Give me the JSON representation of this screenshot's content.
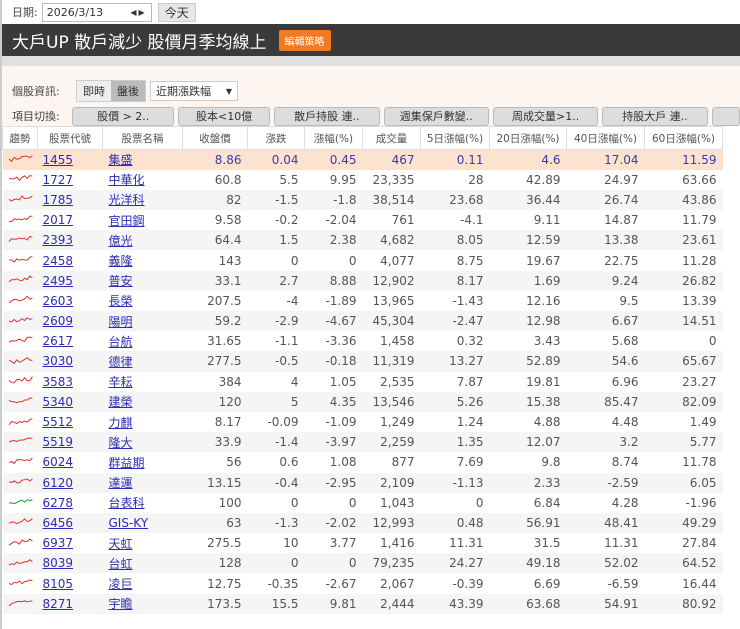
{
  "date_label": "日期:",
  "date_value": "2026/3/13",
  "today_button": "今天",
  "title": "大戶UP 散戶減少 股價月季均線上",
  "edit_button": "編輯策略",
  "info_label": "個股資訊:",
  "info_modes": [
    "即時",
    "盤後"
  ],
  "info_select": "近期漲跌幅",
  "switch_label": "項目切換:",
  "switch_buttons": [
    "股價 > 2..",
    "股本<10億",
    "散戶持股 連..",
    "週集保戶數變..",
    "周成交量>1..",
    "持股大戶 連.."
  ],
  "columns": [
    "趨勢",
    "股票代號",
    "股票名稱",
    "收盤價",
    "漲跌",
    "漲幅(%)",
    "成交量",
    "5日漲幅(%)",
    "20日漲幅(%)",
    "40日漲幅(%)",
    "60日漲幅(%)"
  ],
  "colors": {
    "accent": "#f47a20",
    "up": "#e03030",
    "down": "#2a9a2a",
    "highlight": "#fde3cf"
  },
  "rows": [
    [
      "1455",
      "集盛",
      "8.86",
      "0.04",
      "0.45",
      "467",
      "0.11",
      "4.6",
      "17.04",
      "11.59"
    ],
    [
      "1727",
      "中華化",
      "60.8",
      "5.5",
      "9.95",
      "23,335",
      "28",
      "42.89",
      "24.97",
      "63.66"
    ],
    [
      "1785",
      "光洋科",
      "82",
      "-1.5",
      "-1.8",
      "38,514",
      "23.68",
      "36.44",
      "26.74",
      "43.86"
    ],
    [
      "2017",
      "官田鋼",
      "9.58",
      "-0.2",
      "-2.04",
      "761",
      "-4.1",
      "9.11",
      "14.87",
      "11.79"
    ],
    [
      "2393",
      "億光",
      "64.4",
      "1.5",
      "2.38",
      "4,682",
      "8.05",
      "12.59",
      "13.38",
      "23.61"
    ],
    [
      "2458",
      "義隆",
      "143",
      "0",
      "0",
      "4,077",
      "8.75",
      "19.67",
      "22.75",
      "11.28"
    ],
    [
      "2495",
      "普安",
      "33.1",
      "2.7",
      "8.88",
      "12,902",
      "8.17",
      "1.69",
      "9.24",
      "26.82"
    ],
    [
      "2603",
      "長榮",
      "207.5",
      "-4",
      "-1.89",
      "13,965",
      "-1.43",
      "12.16",
      "9.5",
      "13.39"
    ],
    [
      "2609",
      "陽明",
      "59.2",
      "-2.9",
      "-4.67",
      "45,304",
      "-2.47",
      "12.98",
      "6.67",
      "14.51"
    ],
    [
      "2617",
      "台航",
      "31.65",
      "-1.1",
      "-3.36",
      "1,458",
      "0.32",
      "3.43",
      "5.68",
      "0"
    ],
    [
      "3030",
      "德律",
      "277.5",
      "-0.5",
      "-0.18",
      "11,319",
      "13.27",
      "52.89",
      "54.6",
      "65.67"
    ],
    [
      "3583",
      "辛耘",
      "384",
      "4",
      "1.05",
      "2,535",
      "7.87",
      "19.81",
      "6.96",
      "23.27"
    ],
    [
      "5340",
      "建榮",
      "120",
      "5",
      "4.35",
      "13,546",
      "5.26",
      "15.38",
      "85.47",
      "82.09"
    ],
    [
      "5512",
      "力麒",
      "8.17",
      "-0.09",
      "-1.09",
      "1,249",
      "1.24",
      "4.88",
      "4.48",
      "1.49"
    ],
    [
      "5519",
      "隆大",
      "33.9",
      "-1.4",
      "-3.97",
      "2,259",
      "1.35",
      "12.07",
      "3.2",
      "5.77"
    ],
    [
      "6024",
      "群益期",
      "56",
      "0.6",
      "1.08",
      "877",
      "7.69",
      "9.8",
      "8.74",
      "11.78"
    ],
    [
      "6120",
      "達運",
      "13.15",
      "-0.4",
      "-2.95",
      "2,109",
      "-1.13",
      "2.33",
      "-2.59",
      "6.05"
    ],
    [
      "6278",
      "台表科",
      "100",
      "0",
      "0",
      "1,043",
      "0",
      "6.84",
      "4.28",
      "-1.96"
    ],
    [
      "6456",
      "GIS-KY",
      "63",
      "-1.3",
      "-2.02",
      "12,993",
      "0.48",
      "56.91",
      "48.41",
      "49.29"
    ],
    [
      "6937",
      "天虹",
      "275.5",
      "10",
      "3.77",
      "1,416",
      "11.31",
      "31.5",
      "11.31",
      "27.84"
    ],
    [
      "8039",
      "台虹",
      "128",
      "0",
      "0",
      "79,235",
      "24.27",
      "49.18",
      "52.02",
      "64.52"
    ],
    [
      "8105",
      "凌巨",
      "12.75",
      "-0.35",
      "-2.67",
      "2,067",
      "-0.39",
      "6.69",
      "-6.59",
      "16.44"
    ],
    [
      "8271",
      "宇瞻",
      "173.5",
      "15.5",
      "9.81",
      "2,444",
      "43.39",
      "63.68",
      "54.91",
      "80.92"
    ]
  ]
}
